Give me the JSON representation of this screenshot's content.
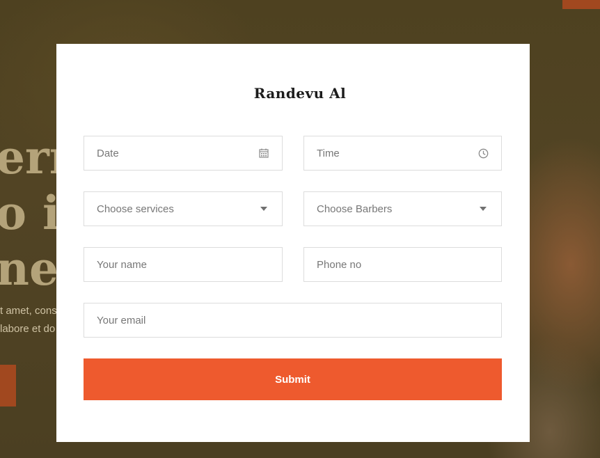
{
  "background": {
    "heading_lines": [
      "ern",
      "o in",
      "ne c"
    ],
    "paragraph_lines": [
      "t amet, cons",
      "labore et do"
    ]
  },
  "form": {
    "title": "Randevu Al",
    "date": {
      "placeholder": "Date",
      "icon": "calendar-icon"
    },
    "time": {
      "placeholder": "Time",
      "icon": "clock-icon"
    },
    "services": {
      "placeholder": "Choose services",
      "icon": "caret-down-icon"
    },
    "barbers": {
      "placeholder": "Choose Barbers",
      "icon": "caret-down-icon"
    },
    "name": {
      "placeholder": "Your name"
    },
    "phone": {
      "placeholder": "Phone no"
    },
    "email": {
      "placeholder": "Your email"
    },
    "submit_label": "Submit"
  },
  "colors": {
    "accent": "#ee5a2e",
    "background_overlay": "#4e4120",
    "modal": "#ffffff",
    "field_border": "#dcdcdc",
    "placeholder_text": "#777777"
  }
}
